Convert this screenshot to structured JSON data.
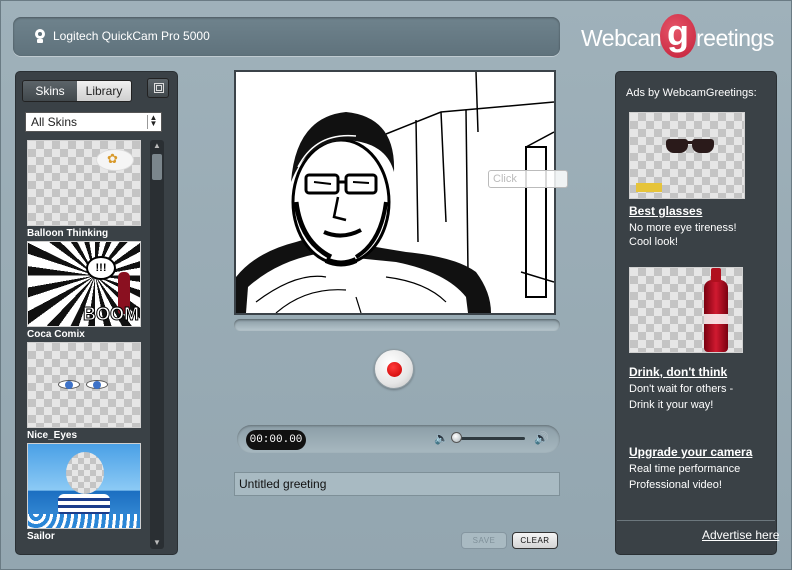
{
  "camera": {
    "label": "Logitech QuickCam Pro 5000"
  },
  "logo": {
    "part1": "Webcam",
    "g": "g",
    "part2": "reetings"
  },
  "library": {
    "tabs": [
      {
        "label": "Skins"
      },
      {
        "label": "Library"
      }
    ],
    "filter": {
      "selected": "All Skins"
    },
    "skins": [
      {
        "name": "Balloon Thinking"
      },
      {
        "name": "Coca Comix",
        "bubble": "!!!",
        "caption": "BOOM"
      },
      {
        "name": "Nice_Eyes"
      },
      {
        "name": "Sailor"
      }
    ]
  },
  "video": {
    "tooltip": "Click"
  },
  "player": {
    "timecode": "00:00.00",
    "volume": 0.05
  },
  "greeting": {
    "title": "Untitled greeting"
  },
  "actions": {
    "save_label": "SAVE",
    "clear_label": "CLEAR"
  },
  "ads": {
    "header": "Ads by WebcamGreetings:",
    "items": [
      {
        "title": "Best glasses",
        "line1": "No more eye tireness!",
        "line2": "Cool look!"
      },
      {
        "title": "Drink, don't think",
        "line1": "Don't wait for others -",
        "line2": "Drink it your way!"
      },
      {
        "title": "Upgrade your camera",
        "line1": "Real time performance",
        "line2": "Professional video!"
      }
    ],
    "advertise_label": "Advertise here"
  },
  "colors": {
    "record": "#d40000",
    "logo_g": "#c4203a",
    "panel": "#3a4146",
    "background": "#9fb1ba"
  }
}
